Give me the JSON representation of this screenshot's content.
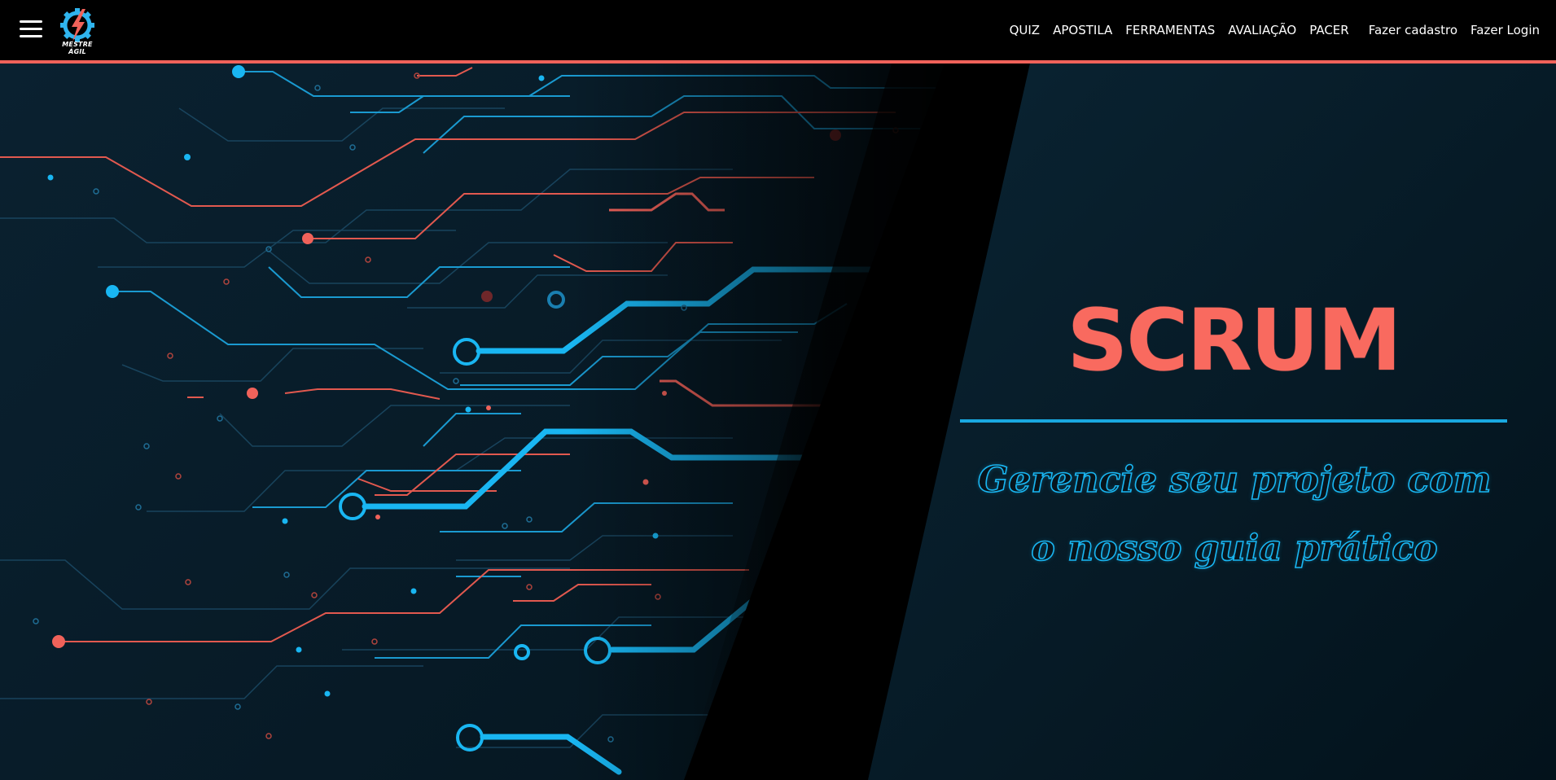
{
  "header": {
    "menu_icon": "hamburger-menu-icon",
    "logo_text": "MESTRE ÁGIL",
    "nav": [
      {
        "label": "QUIZ"
      },
      {
        "label": "APOSTILA"
      },
      {
        "label": "FERRAMENTAS"
      },
      {
        "label": "AVALIAÇÃO"
      },
      {
        "label": "PACER"
      },
      {
        "label": "Fazer cadastro"
      },
      {
        "label": "Fazer Login"
      }
    ]
  },
  "hero": {
    "title": "SCRUM",
    "subtitle": "Gerencie seu projeto com o nosso guia prático"
  },
  "colors": {
    "accent_red": "#f0625a",
    "accent_blue": "#19b6f2",
    "background": "#061a26"
  }
}
